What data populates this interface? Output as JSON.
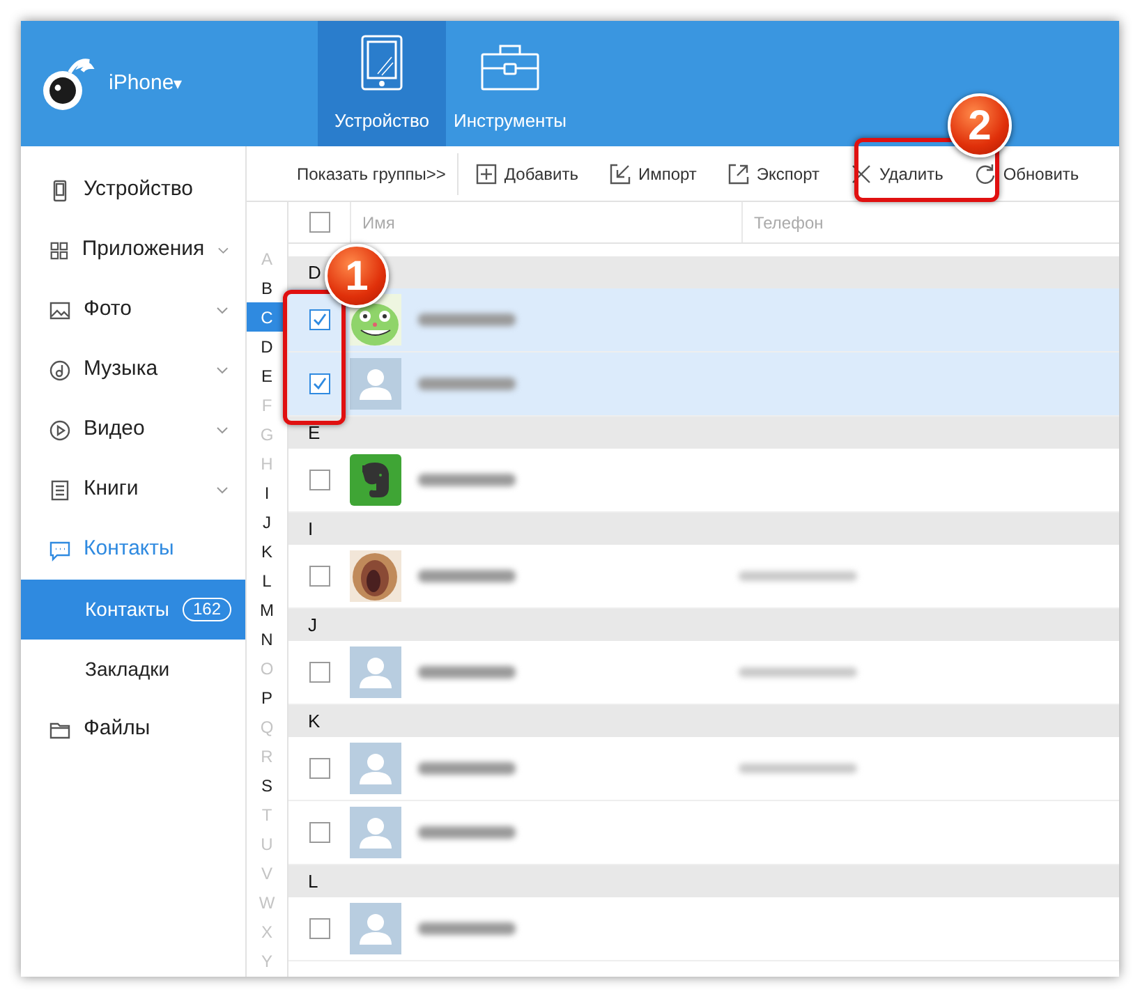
{
  "app": {
    "device_name": "iPhone",
    "dropdown_caret": "▾"
  },
  "top_tabs": [
    {
      "label": "Устройство",
      "kind": "device",
      "selected": true
    },
    {
      "label": "Инструменты",
      "kind": "tools",
      "selected": false
    }
  ],
  "sidebar": {
    "items": [
      {
        "label": "Устройство",
        "kind": "device",
        "active": false
      },
      {
        "label": "Приложения",
        "kind": "apps",
        "active": false,
        "has_caret": true
      },
      {
        "label": "Фото",
        "active": false,
        "has_caret": true
      },
      {
        "label": "Музыка",
        "kind": "music",
        "active": false,
        "has_caret": true
      },
      {
        "label": "Видео",
        "kind": "video",
        "active": false,
        "has_caret": true
      },
      {
        "label": "Книги",
        "kind": "books",
        "active": false,
        "has_caret": true
      },
      {
        "label": "Контакты",
        "kind": "contacts",
        "active": true,
        "children": [
          {
            "label": "Контакты",
            "count": "162",
            "selected": true
          },
          {
            "label": "Закладки",
            "selected": false
          }
        ]
      },
      {
        "label": "Файлы",
        "kind": "files",
        "active": false
      }
    ]
  },
  "toolbar": {
    "groups_toggle": "Показать группы>>",
    "buttons": [
      {
        "label": "Добавить",
        "kind": "add"
      },
      {
        "label": "Импорт",
        "kind": "import"
      },
      {
        "label": "Экспорт",
        "kind": "export"
      },
      {
        "label": "Удалить",
        "kind": "delete"
      },
      {
        "label": "Обновить",
        "kind": "refresh"
      }
    ]
  },
  "table": {
    "select_all_checked": false,
    "columns": [
      "Имя",
      "Телефон"
    ],
    "rows": [
      {
        "kind": "group",
        "label": "D"
      },
      {
        "kind": "contact",
        "avatar": {
          "kind": "cartoon"
        },
        "checked": true,
        "phone_shown": false
      },
      {
        "kind": "contact",
        "avatar": {
          "kind": "default"
        },
        "checked": true,
        "phone_shown": false
      },
      {
        "kind": "group",
        "label": "E"
      },
      {
        "kind": "contact",
        "avatar": {
          "kind": "app"
        },
        "checked": false,
        "phone_shown": false
      },
      {
        "kind": "group",
        "label": "I"
      },
      {
        "kind": "contact",
        "checked": false,
        "phone_shown": true
      },
      {
        "kind": "group",
        "label": "J"
      },
      {
        "kind": "contact",
        "avatar": {
          "kind": "default"
        },
        "checked": false,
        "phone_shown": true
      },
      {
        "kind": "group",
        "label": "K"
      },
      {
        "kind": "contact",
        "avatar": {
          "kind": "default"
        },
        "checked": false,
        "phone_shown": true
      },
      {
        "kind": "contact",
        "avatar": {
          "kind": "default"
        },
        "checked": false,
        "phone_shown": false
      },
      {
        "kind": "group",
        "label": "L"
      },
      {
        "kind": "contact",
        "avatar": {
          "kind": "default"
        },
        "checked": false,
        "phone_shown": false
      }
    ]
  },
  "alphabet": [
    {
      "letter": "A",
      "enabled": false,
      "selected": false
    },
    {
      "letter": "B",
      "enabled": true,
      "selected": false
    },
    {
      "letter": "C",
      "enabled": true,
      "selected": true
    },
    {
      "letter": "D",
      "enabled": true,
      "selected": false
    },
    {
      "letter": "E",
      "enabled": true,
      "selected": false
    },
    {
      "letter": "F",
      "enabled": false,
      "selected": false
    },
    {
      "letter": "G",
      "enabled": false,
      "selected": false
    },
    {
      "letter": "H",
      "enabled": false,
      "selected": false
    },
    {
      "letter": "I",
      "enabled": true,
      "selected": false
    },
    {
      "letter": "J",
      "enabled": true,
      "selected": false
    },
    {
      "letter": "K",
      "enabled": true,
      "selected": false
    },
    {
      "letter": "L",
      "enabled": true,
      "selected": false
    },
    {
      "letter": "M",
      "enabled": true,
      "selected": false
    },
    {
      "letter": "N",
      "enabled": true,
      "selected": false
    },
    {
      "letter": "O",
      "enabled": false,
      "selected": false
    },
    {
      "letter": "P",
      "enabled": true,
      "selected": false
    },
    {
      "letter": "Q",
      "enabled": false,
      "selected": false
    },
    {
      "letter": "R",
      "enabled": false,
      "selected": false
    },
    {
      "letter": "S",
      "enabled": true,
      "selected": false
    },
    {
      "letter": "T",
      "enabled": false,
      "selected": false
    },
    {
      "letter": "U",
      "enabled": false,
      "selected": false
    },
    {
      "letter": "V",
      "enabled": false,
      "selected": false
    },
    {
      "letter": "W",
      "enabled": false,
      "selected": false
    },
    {
      "letter": "X",
      "enabled": false,
      "selected": false
    },
    {
      "letter": "Y",
      "enabled": false,
      "selected": false
    }
  ],
  "annotations": [
    {
      "label": "1"
    },
    {
      "label": "2"
    }
  ]
}
